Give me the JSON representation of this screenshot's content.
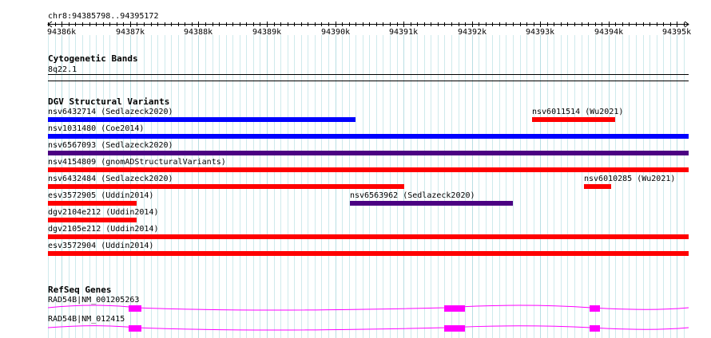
{
  "ruler": {
    "location": "chr8:94385798..94395172",
    "ticks": [
      "94386k",
      "94387k",
      "94388k",
      "94389k",
      "94390k",
      "94391k",
      "94392k",
      "94393k",
      "94394k",
      "94395k"
    ]
  },
  "cytoband": {
    "title": "Cytogenetic Bands",
    "band": "8q22.1"
  },
  "dgv": {
    "title": "DGV Structural Variants",
    "variants": [
      {
        "label": "nsv6432714 (Sedlazeck2020)",
        "color": "#0000ff"
      },
      {
        "label": "nsv6011514 (Wu2021)",
        "color": "#ff0000"
      },
      {
        "label": "nsv1031480 (Coe2014)",
        "color": "#0000ff"
      },
      {
        "label": "nsv6567093 (Sedlazeck2020)",
        "color": "#4b0082"
      },
      {
        "label": "nsv4154809 (gnomADStructuralVariants)",
        "color": "#ff0000"
      },
      {
        "label": "nsv6432484 (Sedlazeck2020)",
        "color": "#ff0000"
      },
      {
        "label": "nsv6010285 (Wu2021)",
        "color": "#ff0000"
      },
      {
        "label": "esv3572905 (Uddin2014)",
        "color": "#ff0000"
      },
      {
        "label": "nsv6563962 (Sedlazeck2020)",
        "color": "#4b0082"
      },
      {
        "label": "dgv2104e212 (Uddin2014)",
        "color": "#ff0000"
      },
      {
        "label": "dgv2105e212 (Uddin2014)",
        "color": "#ff0000"
      },
      {
        "label": "esv3572904 (Uddin2014)",
        "color": "#ff0000"
      }
    ]
  },
  "refseq": {
    "title": "RefSeq Genes",
    "genes": [
      {
        "label": "RAD54B|NM_001205263",
        "color": "#ff00ff"
      },
      {
        "label": "RAD54B|NM_012415",
        "color": "#ff00ff"
      }
    ]
  }
}
